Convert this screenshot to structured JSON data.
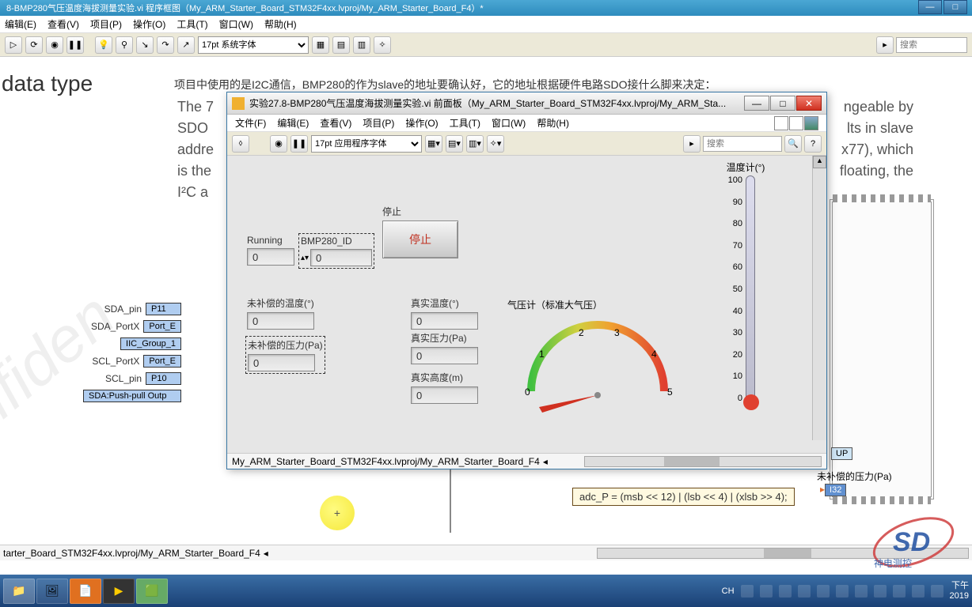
{
  "bg_window": {
    "title": "8-BMP280气压温度海拔测量实验.vi 程序框图（My_ARM_Starter_Board_STM32F4xx.lvproj/My_ARM_Starter_Board_F4）*",
    "menu": [
      "编辑(E)",
      "查看(V)",
      "项目(P)",
      "操作(O)",
      "工具(T)",
      "窗口(W)",
      "帮助(H)"
    ],
    "font_selector": "17pt 系统字体",
    "search_placeholder": "搜索",
    "status_path": "tarter_Board_STM32F4xx.lvproj/My_ARM_Starter_Board_F4"
  },
  "bg_content": {
    "heading": "data type",
    "para1": "项目中使用的是I2C通信，BMP280的作为slave的地址要确认好，它的地址根据硬件电路SDO接什么脚来决定：",
    "para2_left": "The 7\nSDO\naddre\nis the\nI²C a",
    "para2_right": "ngeable by\nlts in slave\nx77), which\nfloating, the",
    "const_nodes": [
      {
        "label": "SDA_pin",
        "val": "P11"
      },
      {
        "label": "SDA_PortX",
        "val": "Port_E"
      },
      {
        "label": "",
        "val": "IIC_Group_1"
      },
      {
        "label": "SCL_PortX",
        "val": "Port_E"
      },
      {
        "label": "SCL_pin",
        "val": "P10"
      },
      {
        "label": "",
        "val": "SDA:Push-pull Outp"
      }
    ],
    "formula": "adc_P = (msb << 12) | (lsb << 4) | (xlsb >> 4);",
    "bottom_label": "未补偿的压力(Pa)",
    "bottom_type": "I32",
    "bottom_up": "UP"
  },
  "fp_window": {
    "title": "实验27.8-BMP280气压温度海拔测量实验.vi 前面板（My_ARM_Starter_Board_STM32F4xx.lvproj/My_ARM_Sta...",
    "menu": [
      "文件(F)",
      "编辑(E)",
      "查看(V)",
      "项目(P)",
      "操作(O)",
      "工具(T)",
      "窗口(W)",
      "帮助(H)"
    ],
    "font_selector": "17pt 应用程序字体",
    "search_placeholder": "搜索",
    "status_path": "My_ARM_Starter_Board_STM32F4xx.lvproj/My_ARM_Starter_Board_F4"
  },
  "fp_controls": {
    "stop_label_title": "停止",
    "stop_btn": "停止",
    "running": {
      "label": "Running",
      "value": "0"
    },
    "bmp_id": {
      "label": "BMP280_ID",
      "value": "0"
    },
    "uncomp_temp": {
      "label": "未补偿的温度(°)",
      "value": "0"
    },
    "uncomp_press": {
      "label": "未补偿的压力(Pa)",
      "value": "0"
    },
    "real_temp": {
      "label": "真实温度(°)",
      "value": "0"
    },
    "real_press": {
      "label": "真实压力(Pa)",
      "value": "0"
    },
    "real_alt": {
      "label": "真实高度(m)",
      "value": "0"
    },
    "gauge_title": "气压计（标准大气压）",
    "gauge_ticks": [
      "0",
      "1",
      "2",
      "3",
      "4",
      "5"
    ],
    "thermo_title": "温度计(°)",
    "thermo_ticks": [
      "100",
      "90",
      "80",
      "70",
      "60",
      "50",
      "40",
      "30",
      "20",
      "10",
      "0"
    ]
  },
  "taskbar": {
    "items": [
      "📁",
      "🖼",
      "📄",
      "▶",
      "🟩"
    ],
    "tray_lang": "CH",
    "tray_time": "下午",
    "tray_date": "2019"
  },
  "logo_text": "神电测控"
}
